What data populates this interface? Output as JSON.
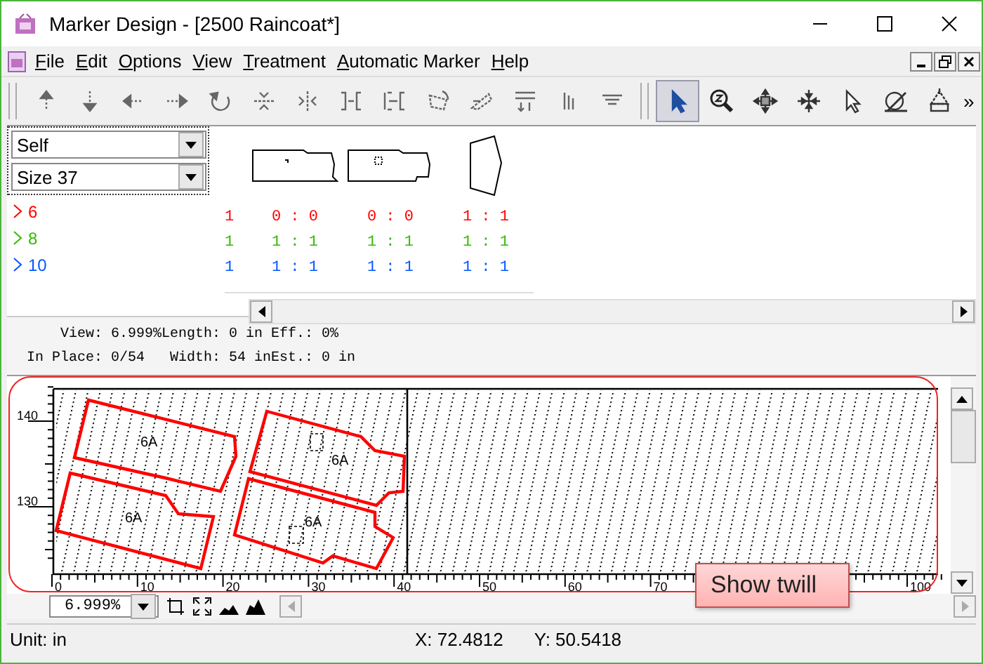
{
  "window": {
    "title": "Marker Design - [2500 Raincoat*]"
  },
  "menu": [
    "File",
    "Edit",
    "Options",
    "View",
    "Treatment",
    "Automatic Marker",
    "Help"
  ],
  "toolbar": {
    "tools": [
      {
        "kind": "up",
        "selected": false
      },
      {
        "kind": "down",
        "selected": false
      },
      {
        "kind": "left",
        "selected": false
      },
      {
        "kind": "right",
        "selected": false
      },
      {
        "kind": "rotate",
        "selected": false
      },
      {
        "kind": "flip_v",
        "selected": false
      },
      {
        "kind": "flip_h",
        "selected": false
      },
      {
        "kind": "join_right",
        "selected": false
      },
      {
        "kind": "join_left",
        "selected": false
      },
      {
        "kind": "tilt",
        "selected": false
      },
      {
        "kind": "skew",
        "selected": false
      },
      {
        "kind": "stack",
        "selected": false
      },
      {
        "kind": "bars",
        "selected": false
      },
      {
        "kind": "lines",
        "selected": false
      },
      {
        "kind": "select",
        "selected": true
      },
      {
        "kind": "zoom",
        "selected": false
      },
      {
        "kind": "move",
        "selected": false
      },
      {
        "kind": "compact",
        "selected": false
      },
      {
        "kind": "cursor",
        "selected": false
      },
      {
        "kind": "pen",
        "selected": false
      },
      {
        "kind": "measure",
        "selected": false
      }
    ],
    "overflow": "»"
  },
  "piece_panel": {
    "fabric": "Self",
    "size": "Size 37",
    "sizes": [
      {
        "label": "6",
        "color": "#ff0000"
      },
      {
        "label": "8",
        "color": "#33bb00"
      },
      {
        "label": "10",
        "color": "#0055ff"
      }
    ],
    "rows": [
      {
        "color": "#ff0000",
        "total": "1",
        "cells": [
          "0 : 0",
          "0 : 0",
          "1 : 1"
        ]
      },
      {
        "color": "#33bb00",
        "total": "1",
        "cells": [
          "1 : 1",
          "1 : 1",
          "1 : 1"
        ]
      },
      {
        "color": "#0055ff",
        "total": "1",
        "cells": [
          "1 : 1",
          "1 : 1",
          "1 : 1"
        ]
      }
    ]
  },
  "info": {
    "line_1": "View: 6.999%Length: 0 in Eff.: 0%",
    "line_2": "In Place: 0/54   Width: 54 inEst.: 0 in"
  },
  "marker": {
    "pieces": [
      {
        "label": "6A"
      },
      {
        "label": "6A"
      },
      {
        "label": "6A"
      },
      {
        "label": "6A"
      }
    ],
    "x_labels": [
      "0",
      "10",
      "20",
      "30",
      "40",
      "50",
      "60",
      "70",
      "100"
    ],
    "y_labels": [
      "140",
      "130"
    ],
    "zoom": "6.999%"
  },
  "callout": {
    "text": "Show twill"
  },
  "status_bar": {
    "unit": "Unit: in",
    "x": "X: 72.4812",
    "y": "Y: 50.5418"
  }
}
